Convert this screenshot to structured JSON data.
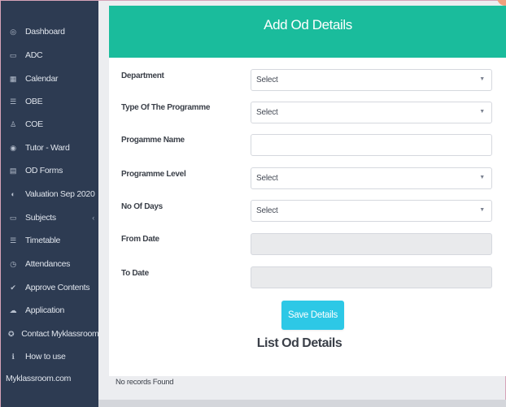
{
  "sidebar": {
    "items": [
      {
        "icon": "◎",
        "icon_name": "dashboard-icon",
        "label": "Dashboard"
      },
      {
        "icon": "▭",
        "icon_name": "book-icon",
        "label": "ADC"
      },
      {
        "icon": "▦",
        "icon_name": "calendar-icon",
        "label": "Calendar"
      },
      {
        "icon": "☰",
        "icon_name": "list-icon",
        "label": "OBE"
      },
      {
        "icon": "♙",
        "icon_name": "user-icon",
        "label": "COE"
      },
      {
        "icon": "◉",
        "icon_name": "circle-icon",
        "label": "Tutor - Ward"
      },
      {
        "icon": "▤",
        "icon_name": "form-icon",
        "label": "OD Forms"
      },
      {
        "icon": "◐",
        "icon_name": "evaluation-icon",
        "label": "Valuation Sep 2020"
      },
      {
        "icon": "▭",
        "icon_name": "book-icon",
        "label": "Subjects"
      },
      {
        "icon": "☰",
        "icon_name": "timetable-icon",
        "label": "Timetable"
      },
      {
        "icon": "◷",
        "icon_name": "clock-icon",
        "label": "Attendances"
      },
      {
        "icon": "✔",
        "icon_name": "check-icon",
        "label": "Approve Contents"
      },
      {
        "icon": "☁",
        "icon_name": "cloud-icon",
        "label": "Application"
      },
      {
        "icon": "✪",
        "icon_name": "contact-icon",
        "label": "Contact Myklassroom"
      },
      {
        "icon": "ℹ",
        "icon_name": "info-icon",
        "label": "How to use"
      }
    ],
    "subjects_caret": "‹",
    "footer": "Myklassroom.com"
  },
  "form": {
    "title": "Add Od Details",
    "fields": {
      "department": {
        "label": "Department",
        "value": "Select"
      },
      "programme_type": {
        "label": "Type Of The Programme",
        "value": "Select"
      },
      "programme_name": {
        "label": "Progamme Name",
        "value": ""
      },
      "programme_level": {
        "label": "Programme Level",
        "value": "Select"
      },
      "no_of_days": {
        "label": "No Of Days",
        "value": "Select"
      },
      "from_date": {
        "label": "From Date",
        "value": ""
      },
      "to_date": {
        "label": "To Date",
        "value": ""
      }
    },
    "save_label": "Save Details"
  },
  "list": {
    "title": "List Od Details",
    "empty_text": "No records Found"
  },
  "colors": {
    "sidebar_bg": "#2d3b52",
    "header_bg": "#1abc9c",
    "button_bg": "#2dc8e6"
  }
}
